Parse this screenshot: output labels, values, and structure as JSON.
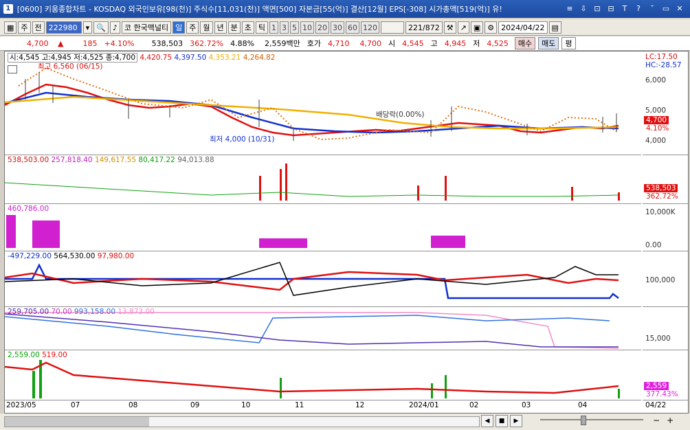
{
  "titlebar": {
    "num": "1",
    "text": "[0600] 키움종합차트 - KOSDAQ 외국인보유[98(천)] 주식수[11,031(천)] 액면[500] 자본금[55(억)] 결산[12월] EPS[-308] 시가총액[519(억)] 유!",
    "buttons": [
      "≡",
      "⇩",
      "⊡",
      "⊟",
      "T",
      "?",
      "ˇ",
      "▭",
      "✕"
    ]
  },
  "toolbar": {
    "type1": "주",
    "type2": "전",
    "code": "222980",
    "name": "한국맥널티",
    "periods": [
      "일",
      "주",
      "월",
      "년",
      "분",
      "초",
      "틱"
    ],
    "selected_period": "일",
    "nums": [
      "1",
      "3",
      "5",
      "10",
      "20",
      "30",
      "60",
      "120"
    ],
    "count": "221",
    "total": "/872",
    "date": "2024/04/22"
  },
  "quote": {
    "price": "4,700",
    "arrow": "▲",
    "change": "185",
    "rate": "+4.10%",
    "volume": "538,503",
    "volrate": "362.72%",
    "turnover": "4.88%",
    "amount": "2,559백만",
    "hoga_label": "호가",
    "ask": "4,710",
    "bid": "4,700",
    "open_label": "시",
    "open": "4,545",
    "high_label": "고",
    "high": "4,945",
    "low_label": "저",
    "low": "4,525",
    "buy": "매수",
    "sell": "매도",
    "avg": "평"
  },
  "panels": {
    "price": {
      "legend_ohlc": "시:4,545 고:4,945 저:4,525 종:4,700",
      "ma": [
        "4,420.75",
        "4,397.50",
        "4,353.21",
        "4,264.82"
      ],
      "colors": [
        "#e01010",
        "#1030d0",
        "#f0b000",
        "#d06000"
      ],
      "yticks": [
        "6,000",
        "5,000",
        "4,000"
      ],
      "top_labels": [
        "LC:17.50",
        "HC:-28.57"
      ],
      "current_box": "4,700",
      "rate_box": "4.10%",
      "high_note": "최고 6,560 (06/15)",
      "low_note": "최저 4,000 (10/31)",
      "div_note": "배당락(0.00%)"
    },
    "volume": {
      "legend": [
        "538,503.00",
        "257,818.40",
        "149,617.55",
        "80,417.22",
        "94,013.88"
      ],
      "colors": [
        "#d01010",
        "#c020c0",
        "#d09000",
        "#10a010",
        "#606060"
      ],
      "box": "538,503",
      "rate": "362.72%"
    },
    "osc": {
      "legend": "460,786.00",
      "yticks": [
        "10,000K",
        "0.00"
      ]
    },
    "investor": {
      "legend": [
        "-497,229.00",
        "564,530.00",
        "97,980.00"
      ],
      "ytick": "100,000"
    },
    "holding": {
      "legend": [
        "259,705.00",
        "70.00",
        "993,158.00",
        "13,873.00"
      ],
      "ytick": "15,000"
    },
    "amount": {
      "legend": [
        "2,559.00",
        "519.00"
      ],
      "box": "2,559",
      "rate": "377.43%"
    }
  },
  "xaxis": [
    "2023/05",
    "07",
    "08",
    "09",
    "10",
    "11",
    "12",
    "2024/01",
    "02",
    "03",
    "04",
    "04/22"
  ],
  "bottom": {
    "minus": "−",
    "plus": "+"
  }
}
